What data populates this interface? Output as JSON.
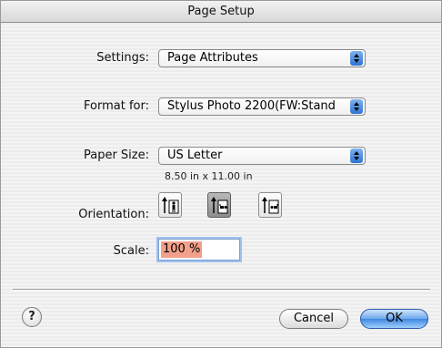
{
  "window": {
    "title": "Page Setup"
  },
  "settings": {
    "label": "Settings:",
    "value": "Page Attributes"
  },
  "format_for": {
    "label": "Format for:",
    "value": "Stylus Photo 2200(FW:Stand"
  },
  "paper_size": {
    "label": "Paper Size:",
    "value": "US Letter",
    "dimensions": "8.50 in x 11.00 in"
  },
  "orientation": {
    "label": "Orientation:",
    "options": [
      "portrait",
      "landscape-left",
      "landscape-right"
    ],
    "selected": "landscape-left"
  },
  "scale": {
    "label": "Scale:",
    "value": "100 %"
  },
  "buttons": {
    "help": "?",
    "cancel": "Cancel",
    "ok": "OK"
  },
  "colors": {
    "accent": "#3f86e2",
    "selection": "#f2a08a"
  }
}
